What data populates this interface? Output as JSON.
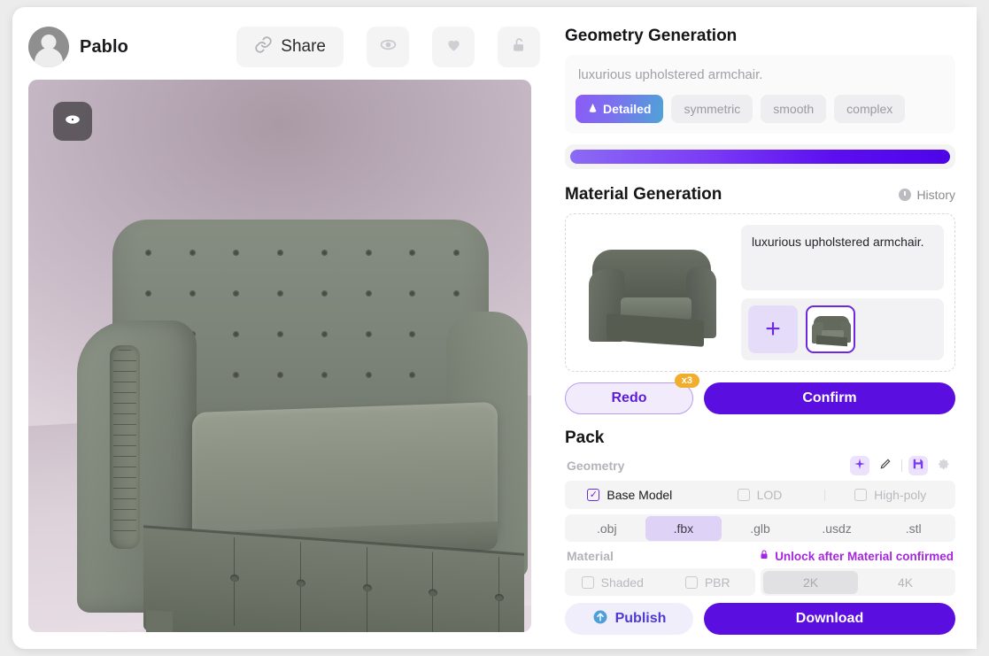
{
  "header": {
    "username": "Pablo",
    "share_label": "Share",
    "avatar_icon": "user-avatar-icon",
    "link_icon": "link-icon",
    "eye_icon": "eye-icon",
    "heart_icon": "heart-icon",
    "unlock_icon": "unlock-icon"
  },
  "viewport": {
    "overlay_eye_icon": "eye-icon",
    "model_name": "luxurious upholstered armchair"
  },
  "geometry": {
    "title": "Geometry Generation",
    "prompt": "luxurious upholstered armchair.",
    "tags": [
      {
        "label": "Detailed",
        "active": true,
        "icon": "cone-icon"
      },
      {
        "label": "symmetric",
        "active": false
      },
      {
        "label": "smooth",
        "active": false
      },
      {
        "label": "complex",
        "active": false
      }
    ],
    "progress_percent": 100
  },
  "material": {
    "title": "Material Generation",
    "history_label": "History",
    "history_icon": "clock-icon",
    "prompt": "luxurious upholstered armchair.",
    "add_label": "+",
    "redo_label": "Redo",
    "redo_badge": "x3",
    "confirm_label": "Confirm"
  },
  "pack": {
    "title": "Pack",
    "geometry_label": "Geometry",
    "tool_icons": [
      {
        "name": "sparkle-icon",
        "lit": true
      },
      {
        "name": "pencil-icon",
        "lit": false
      },
      {
        "name": "save-icon",
        "lit": true
      },
      {
        "name": "gear-icon",
        "lit": false
      }
    ],
    "geometry_options": [
      {
        "label": "Base Model",
        "checked": true,
        "disabled": false
      },
      {
        "label": "LOD",
        "checked": false,
        "disabled": true
      },
      {
        "label": "High-poly",
        "checked": false,
        "disabled": true
      }
    ],
    "formats": [
      {
        "label": ".obj",
        "selected": false
      },
      {
        "label": ".fbx",
        "selected": true
      },
      {
        "label": ".glb",
        "selected": false
      },
      {
        "label": ".usdz",
        "selected": false
      },
      {
        "label": ".stl",
        "selected": false
      }
    ],
    "material_label": "Material",
    "lock_label": "Unlock after Material confirmed",
    "lock_icon": "lock-icon",
    "material_options": [
      {
        "label": "Shaded",
        "checked": false,
        "disabled": true
      },
      {
        "label": "PBR",
        "checked": false,
        "disabled": true
      }
    ],
    "resolutions": [
      {
        "label": "2K",
        "selected": true
      },
      {
        "label": "4K",
        "selected": false
      }
    ],
    "publish_label": "Publish",
    "publish_icon": "upload-circle-icon",
    "download_label": "Download"
  },
  "colors": {
    "accent_purple": "#5b0ee0",
    "light_purple": "#e5dcf9",
    "badge_orange": "#f0ae2c",
    "lock_magenta": "#a626e0",
    "publish_blue": "#4e9fd8"
  }
}
